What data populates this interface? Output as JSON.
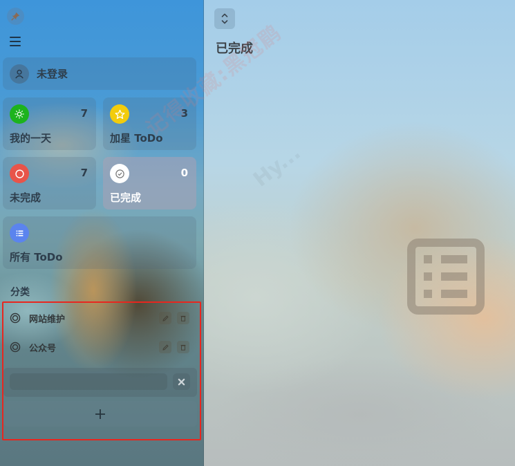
{
  "sidebar": {
    "pin_icon": "pin-icon",
    "menu_icon": "hamburger-menu-icon",
    "user": {
      "label": "未登录",
      "icon": "user-icon"
    },
    "smart_lists": [
      {
        "id": "my-day",
        "label": "我的一天",
        "count": "7",
        "icon": "sun-icon",
        "color": "#1db31d"
      },
      {
        "id": "starred",
        "label": "加星 ToDo",
        "count": "3",
        "icon": "star-icon",
        "color": "#f2cc0c"
      },
      {
        "id": "incomplete",
        "label": "未完成",
        "count": "7",
        "icon": "circle-icon",
        "color": "#e8544a"
      },
      {
        "id": "completed",
        "label": "已完成",
        "count": "0",
        "icon": "check-circle-icon",
        "color": "#ffffff",
        "active": true
      },
      {
        "id": "all",
        "label": "所有 ToDo",
        "count": "",
        "icon": "list-icon",
        "color": "#5b84ee"
      }
    ],
    "categories_title": "分类",
    "categories": [
      {
        "label": "网站维护",
        "icon": "target-icon",
        "edit_icon": "pencil-icon",
        "delete_icon": "trash-icon"
      },
      {
        "label": "公众号",
        "icon": "target-icon",
        "edit_icon": "pencil-icon",
        "delete_icon": "trash-icon"
      }
    ],
    "new_category": {
      "value": "",
      "placeholder": ""
    },
    "close_icon": "close-icon",
    "add_icon": "plus-icon"
  },
  "main": {
    "sort_icon": "sort-updown-icon",
    "title": "已完成",
    "empty_icon": "list-box-icon"
  },
  "watermark": {
    "text": "记得收藏:黑冠鹛",
    "text2": "Hy..."
  },
  "colors": {
    "highlight": "#e8261e",
    "text": "#2e3e4c"
  }
}
